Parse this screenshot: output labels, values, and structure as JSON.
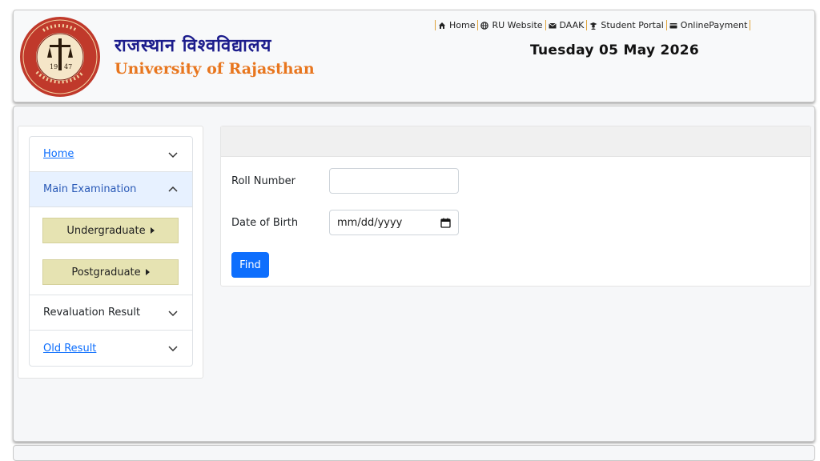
{
  "header": {
    "hindi_title": "राजस्थान विश्वविद्यालय",
    "english_title": "University of Rajasthan",
    "seal_year_left": "19",
    "seal_year_right": "47",
    "date": "Tuesday 05 May 2026",
    "nav": [
      {
        "label": "Home",
        "icon": "home-icon"
      },
      {
        "label": "RU Website",
        "icon": "globe-icon"
      },
      {
        "label": "DAAK",
        "icon": "mail-icon"
      },
      {
        "label": "Student Portal",
        "icon": "graduate-icon"
      },
      {
        "label": "OnlinePayment",
        "icon": "card-icon"
      }
    ]
  },
  "sidebar": {
    "home": "Home",
    "main_exam": "Main Examination",
    "undergraduate": "Undergraduate",
    "postgraduate": "Postgraduate",
    "revaluation": "Revaluation Result",
    "old_result": "Old Result"
  },
  "form": {
    "roll_label": "Roll Number",
    "roll_value": "",
    "dob_label": "Date of Birth",
    "dob_placeholder": "mm/dd/yyyy",
    "find_label": "Find"
  },
  "colors": {
    "accent": "#0d6efd",
    "brand_orange": "#e8761e",
    "brand_blue": "#1c1c8c",
    "seal_red": "#b8322e"
  }
}
